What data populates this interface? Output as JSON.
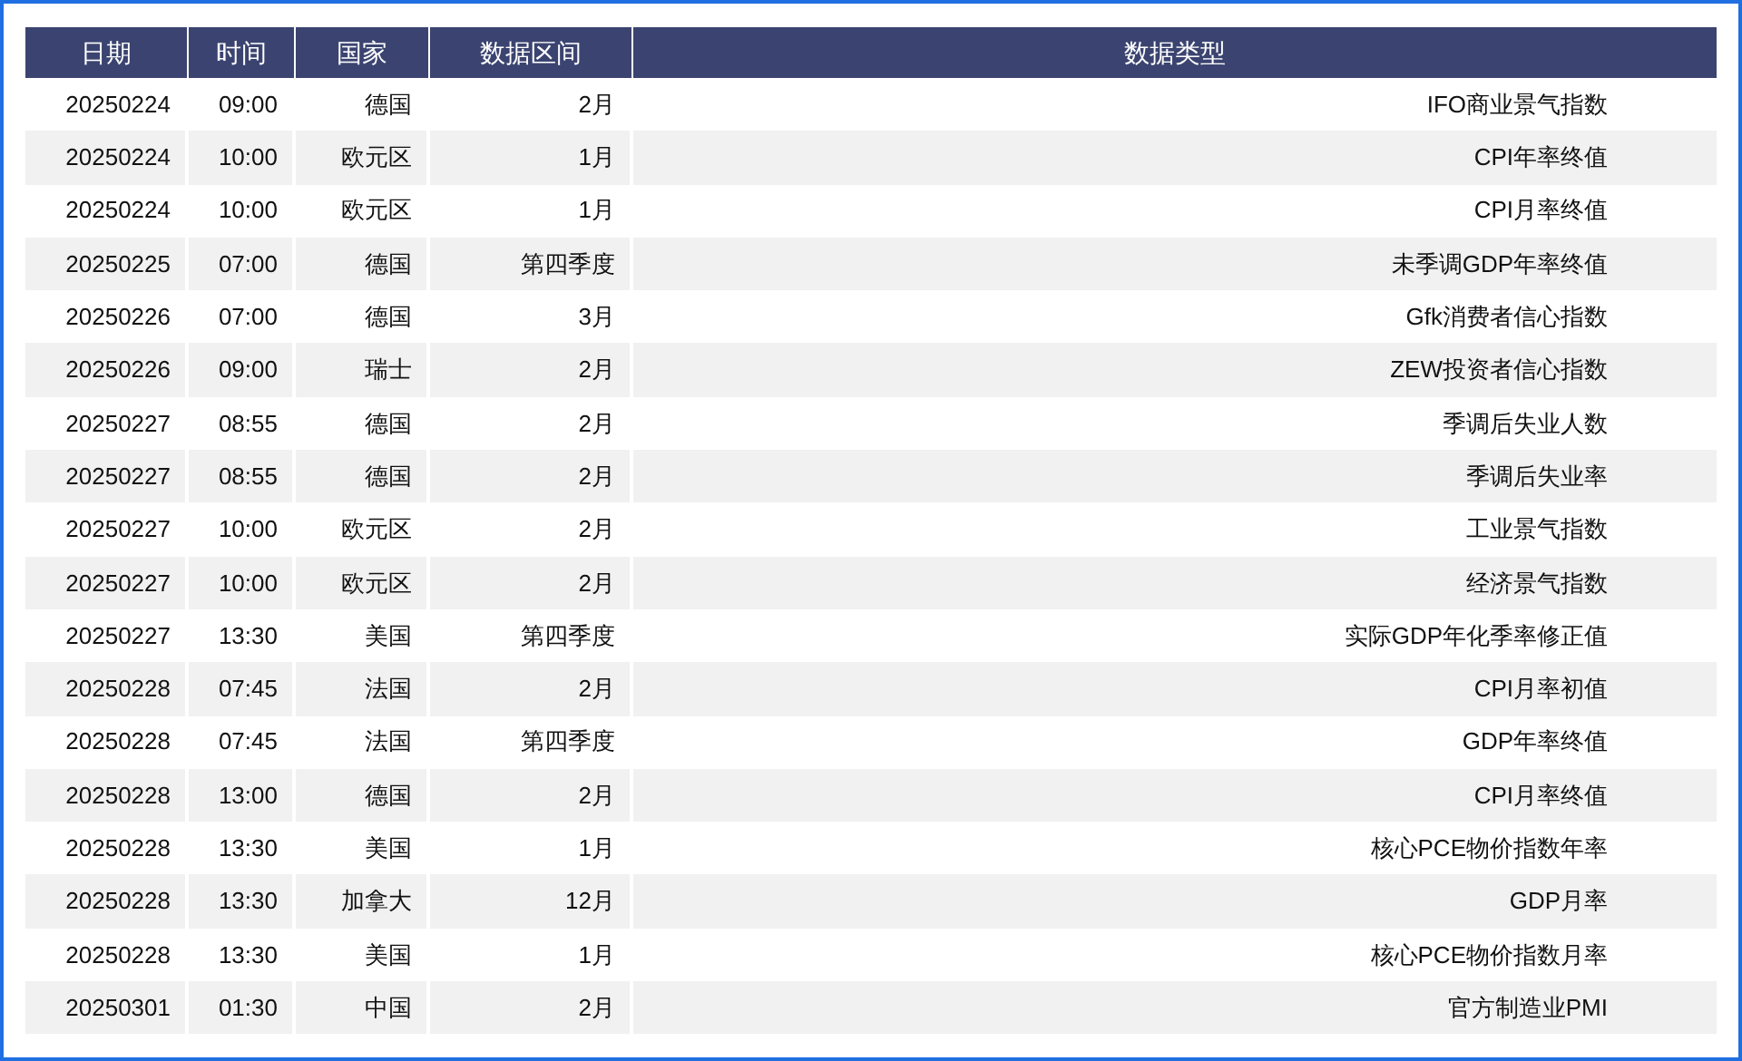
{
  "table": {
    "columns": [
      "日期",
      "时间",
      "国家",
      "数据区间",
      "数据类型"
    ],
    "rows": [
      [
        "20250224",
        "09:00",
        "德国",
        "2月",
        "IFO商业景气指数"
      ],
      [
        "20250224",
        "10:00",
        "欧元区",
        "1月",
        "CPI年率终值"
      ],
      [
        "20250224",
        "10:00",
        "欧元区",
        "1月",
        "CPI月率终值"
      ],
      [
        "20250225",
        "07:00",
        "德国",
        "第四季度",
        "未季调GDP年率终值"
      ],
      [
        "20250226",
        "07:00",
        "德国",
        "3月",
        "Gfk消费者信心指数"
      ],
      [
        "20250226",
        "09:00",
        "瑞士",
        "2月",
        "ZEW投资者信心指数"
      ],
      [
        "20250227",
        "08:55",
        "德国",
        "2月",
        "季调后失业人数"
      ],
      [
        "20250227",
        "08:55",
        "德国",
        "2月",
        "季调后失业率"
      ],
      [
        "20250227",
        "10:00",
        "欧元区",
        "2月",
        "工业景气指数"
      ],
      [
        "20250227",
        "10:00",
        "欧元区",
        "2月",
        "经济景气指数"
      ],
      [
        "20250227",
        "13:30",
        "美国",
        "第四季度",
        "实际GDP年化季率修正值"
      ],
      [
        "20250228",
        "07:45",
        "法国",
        "2月",
        "CPI月率初值"
      ],
      [
        "20250228",
        "07:45",
        "法国",
        "第四季度",
        "GDP年率终值"
      ],
      [
        "20250228",
        "13:00",
        "德国",
        "2月",
        "CPI月率终值"
      ],
      [
        "20250228",
        "13:30",
        "美国",
        "1月",
        "核心PCE物价指数年率"
      ],
      [
        "20250228",
        "13:30",
        "加拿大",
        "12月",
        "GDP月率"
      ],
      [
        "20250228",
        "13:30",
        "美国",
        "1月",
        "核心PCE物价指数月率"
      ],
      [
        "20250301",
        "01:30",
        "中国",
        "2月",
        "官方制造业PMI"
      ]
    ]
  }
}
